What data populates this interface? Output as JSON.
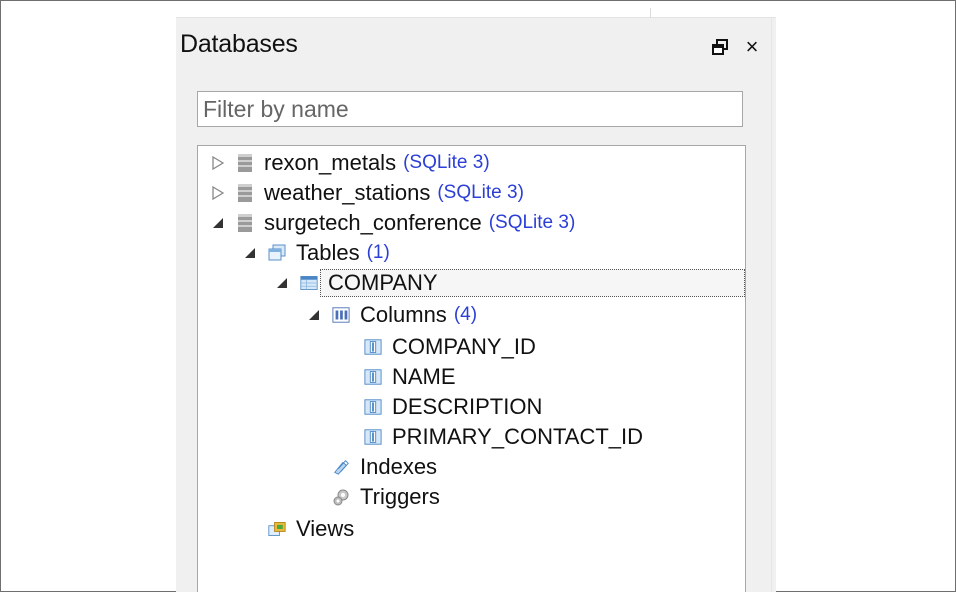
{
  "panel": {
    "title": "Databases",
    "restore_icon": "restore-window-icon",
    "close_symbol": "×"
  },
  "filter": {
    "placeholder": "Filter by name",
    "value": ""
  },
  "colors": {
    "accent_text": "#2b3fd6",
    "panel_bg": "#f0f0f0",
    "border": "#a7a7a7"
  },
  "tree": {
    "databases": [
      {
        "name": "rexon_metals",
        "engine": "(SQLite 3)",
        "expanded": false
      },
      {
        "name": "weather_stations",
        "engine": "(SQLite 3)",
        "expanded": false
      },
      {
        "name": "surgetech_conference",
        "engine": "(SQLite 3)",
        "expanded": true
      }
    ],
    "tables_node": {
      "label": "Tables",
      "count": "(1)"
    },
    "table": {
      "name": "COMPANY"
    },
    "columns_node": {
      "label": "Columns",
      "count": "(4)"
    },
    "columns": [
      "COMPANY_ID",
      "NAME",
      "DESCRIPTION",
      "PRIMARY_CONTACT_ID"
    ],
    "indexes_node": {
      "label": "Indexes"
    },
    "triggers_node": {
      "label": "Triggers"
    },
    "views_node": {
      "label": "Views"
    }
  }
}
